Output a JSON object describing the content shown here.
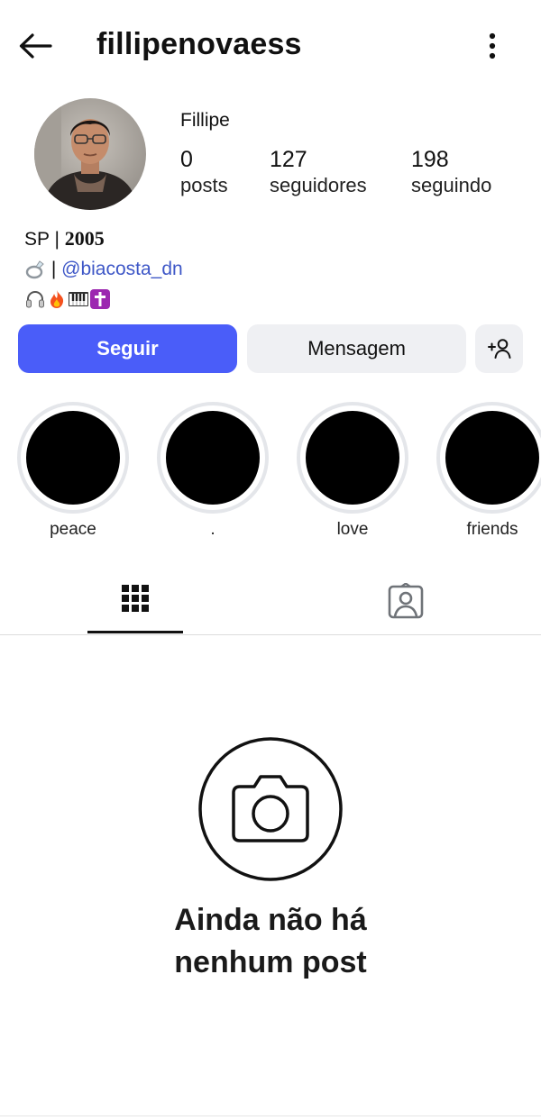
{
  "header": {
    "username": "fillipenovaess"
  },
  "profile": {
    "display_name": "Fillipe",
    "stats": [
      {
        "value": "0",
        "label": "posts"
      },
      {
        "value": "127",
        "label": "seguidores"
      },
      {
        "value": "198",
        "label": "seguindo"
      }
    ]
  },
  "bio": {
    "line1_prefix": "SP | ",
    "line1_year": "2005",
    "line2_sep": " | ",
    "line2_link": "@biacosta_dn",
    "emojis_line3": [
      "headphones-emoji",
      "fire-emoji",
      "piano-keys-emoji",
      "latin-cross-emoji"
    ],
    "ring_emoji": "ring-emoji"
  },
  "actions": {
    "follow_label": "Seguir",
    "message_label": "Mensagem",
    "follow_color": "#4a5df9"
  },
  "highlights": [
    {
      "label": "peace"
    },
    {
      "label": "."
    },
    {
      "label": "love"
    },
    {
      "label": "friends"
    }
  ],
  "tabs": [
    {
      "icon": "grid-icon",
      "selected": true
    },
    {
      "icon": "tagged-user-icon",
      "selected": false
    }
  ],
  "empty_state": {
    "title_line1": "Ainda não há",
    "title_line2": "nenhum post",
    "icon": "camera-icon"
  }
}
